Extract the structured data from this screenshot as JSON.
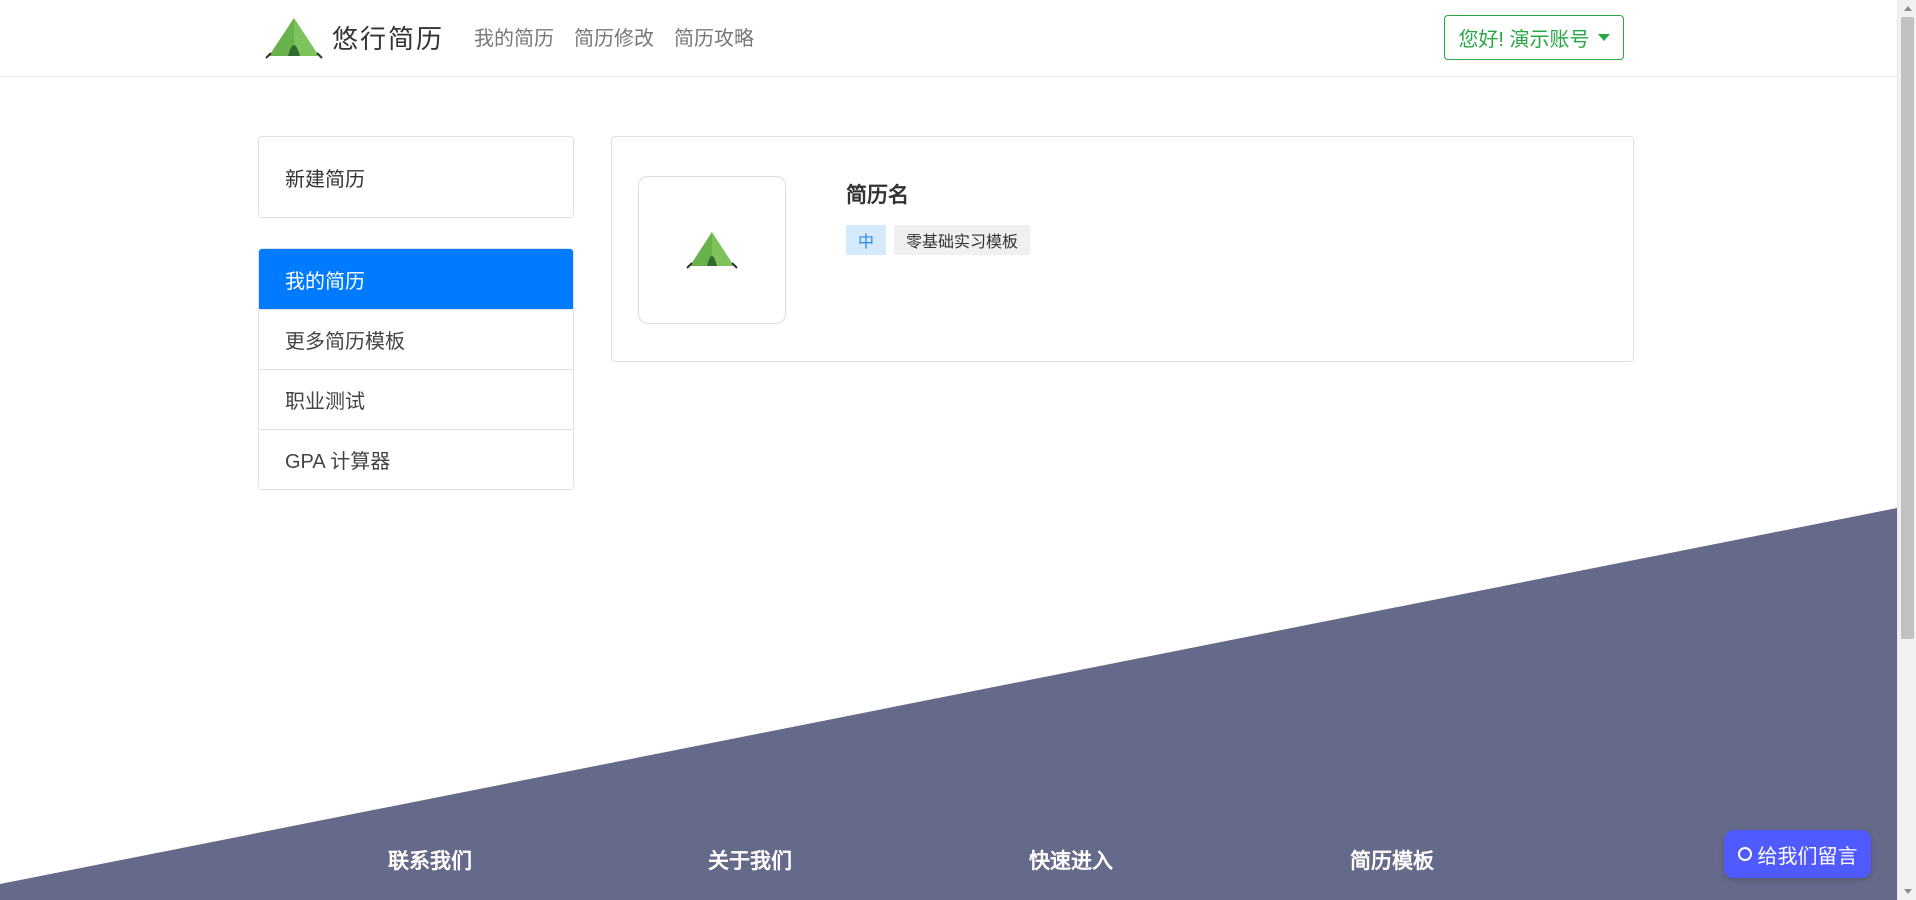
{
  "header": {
    "brand_name": "悠行简历",
    "logo_icon": "tent-logo-icon",
    "nav": [
      {
        "label": "我的简历"
      },
      {
        "label": "简历修改"
      },
      {
        "label": "简历攻略"
      }
    ],
    "user_button": "您好! 演示账号"
  },
  "sidebar": {
    "new_resume": "新建简历",
    "items": [
      {
        "label": "我的简历",
        "active": true
      },
      {
        "label": "更多简历模板",
        "active": false
      },
      {
        "label": "职业测试",
        "active": false
      },
      {
        "label": "GPA 计算器",
        "active": false
      }
    ]
  },
  "resume": {
    "name": "简历名",
    "level_tag": "中",
    "template_tag": "零基础实习模板"
  },
  "footer": {
    "headings": [
      "联系我们",
      "关于我们",
      "快速进入",
      "简历模板"
    ]
  },
  "fab": {
    "label": "给我们留言",
    "icon": "circle-chat-icon"
  },
  "colors": {
    "primary": "#007bff",
    "success": "#28a745",
    "footer": "#666a8a",
    "fab": "#4f5bff"
  }
}
